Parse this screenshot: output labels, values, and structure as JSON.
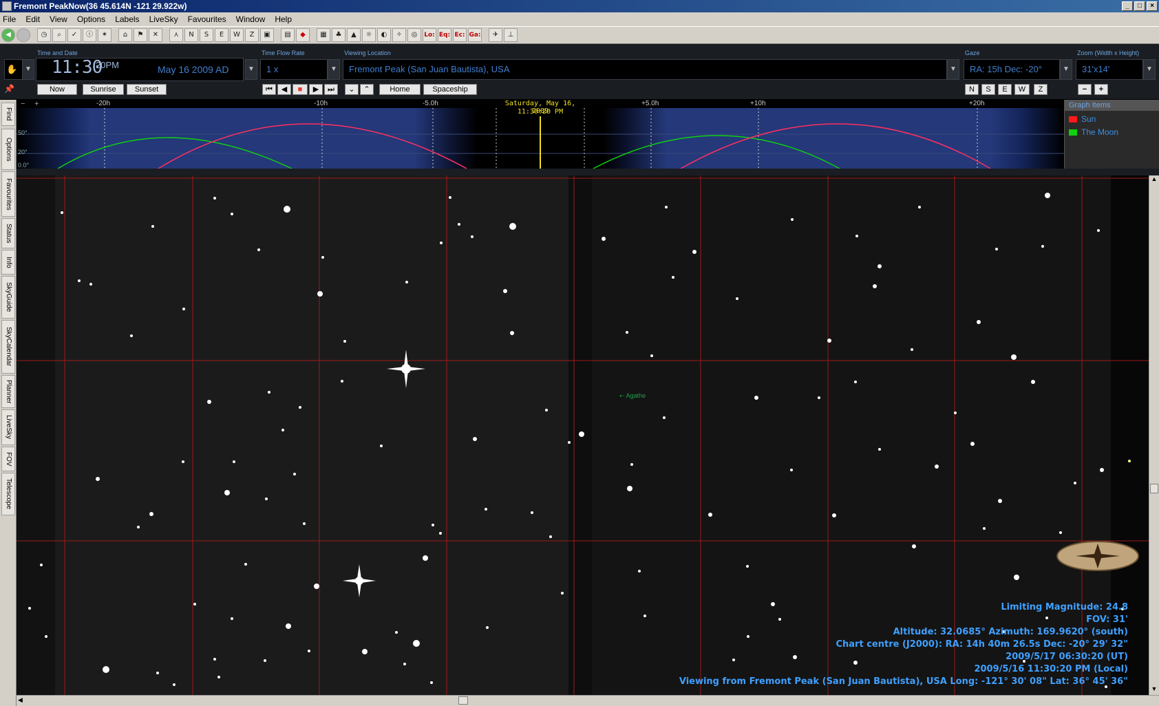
{
  "window": {
    "title": "Fremont PeakNow(36  45.614N  -121 29.922w)"
  },
  "menu": [
    "File",
    "Edit",
    "View",
    "Options",
    "Labels",
    "LiveSky",
    "Favourites",
    "Window",
    "Help"
  ],
  "toolbar": {
    "buttons": [
      "back-icon",
      "stop-icon",
      "clock-icon",
      "zoom-icon",
      "check-icon",
      "info-icon",
      "stars-icon",
      "home-icon",
      "flag-icon",
      "x-icon",
      "telescope-icon",
      "n-icon",
      "s-icon",
      "e-icon",
      "w-icon",
      "z-icon",
      "screen-icon",
      "chart-icon",
      "diamond-icon",
      "grid-icon",
      "tree-icon",
      "mountain-icon",
      "sun-icon",
      "moon-icon",
      "constellation-icon",
      "target-icon"
    ],
    "coord_labels": [
      "Lo:",
      "Eq:",
      "Ec:",
      "Ga:"
    ]
  },
  "controls": {
    "time_label": "Time and Date",
    "clock": "11:30",
    "ampm": "20PM",
    "date": "May 16   2009 AD",
    "rate_label": "Time Flow Rate",
    "rate": "1 x",
    "location_label": "Viewing Location",
    "location": "Fremont Peak (San Juan Bautista), USA",
    "gaze_label": "Gaze",
    "gaze": "RA: 15h Dec: -20°",
    "zoom_label": "Zoom (Width x Height)",
    "zoom": "31'x14'",
    "now_btn": "Now",
    "sunrise_btn": "Sunrise",
    "sunset_btn": "Sunset",
    "home_btn": "Home",
    "spaceship_btn": "Spaceship",
    "compass": [
      "N",
      "S",
      "E",
      "W",
      "Z"
    ],
    "zoom_minus": "−",
    "zoom_plus": "+"
  },
  "timeline": {
    "ticks": [
      "-20h",
      "-10h",
      "-5.0h",
      "+5.0h",
      "+10h",
      "+20h"
    ],
    "y_ticks": [
      "50°",
      "20°",
      "0.0°"
    ],
    "current_date": "Saturday, May 16, 2009",
    "current_time": "11:30:20 PM",
    "legend_title": "Graph Items",
    "legend": [
      {
        "name": "Sun",
        "color": "#ff1a1a"
      },
      {
        "name": "The Moon",
        "color": "#10d010"
      }
    ]
  },
  "sidetabs": [
    "Find",
    "Options",
    "Favourites",
    "Status",
    "Info",
    "SkyGuide",
    "SkyCalendar",
    "Planner",
    "LiveSky",
    "FOV",
    "Telescope"
  ],
  "sky": {
    "object_label": "Agathe",
    "info": {
      "limiting": "Limiting Magnitude: 24.8",
      "fov": "FOV: 31'",
      "altaz": "Altitude: 32.0685° Azimuth: 169.9620° (south)",
      "centre": "Chart centre (J2000): RA: 14h 40m 26.5s Dec: -20° 29' 32\"",
      "ut": "2009/5/17 06:30:20 (UT)",
      "local": "2009/5/16 11:30:20 PM (Local)",
      "viewing": "Viewing from Fremont Peak (San Juan Bautista), USA    Long: -121° 30' 08\" Lat: 36° 45' 36\""
    }
  }
}
